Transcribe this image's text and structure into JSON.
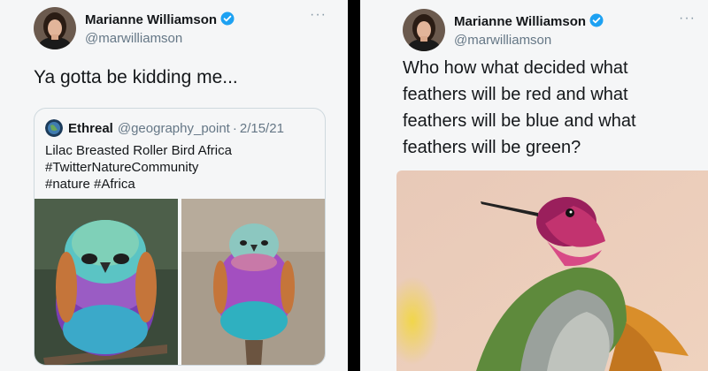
{
  "left_tweet": {
    "display_name": "Marianne Williamson",
    "handle": "@marwilliamson",
    "text": "Ya gotta be kidding me...",
    "more_icon": "more-icon",
    "quote": {
      "display_name": "Ethreal",
      "handle": "@geography_point",
      "separator": "·",
      "date": "2/15/21",
      "lines": [
        "Lilac Breasted Roller Bird Africa",
        "#TwitterNatureCommunity",
        "#nature #Africa"
      ]
    }
  },
  "right_tweet": {
    "display_name": "Marianne Williamson",
    "handle": "@marwilliamson",
    "more_icon": "more-icon",
    "lines": [
      "Who how what decided what",
      "feathers will be red and what",
      "feathers will be blue and what",
      "feathers will be green?"
    ]
  },
  "colors": {
    "verified_blue": "#1da1f2",
    "background": "#f5f6f7",
    "text": "#14171a",
    "secondary_text": "#657786",
    "divider": "#000000"
  }
}
